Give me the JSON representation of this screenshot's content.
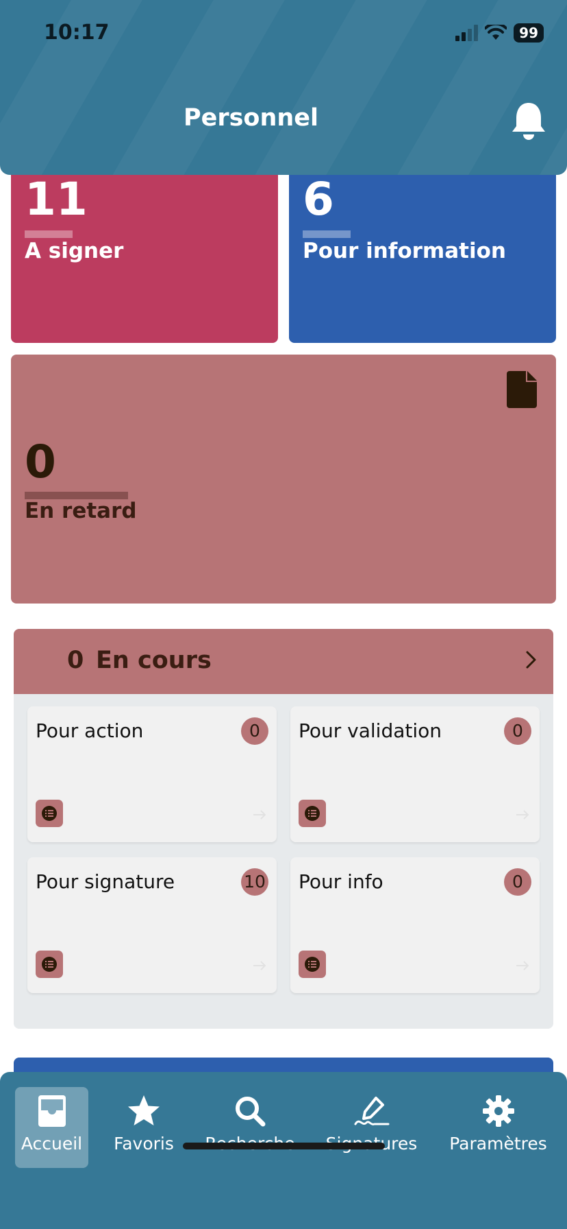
{
  "status_bar": {
    "time": "10:17",
    "battery": "99"
  },
  "header": {
    "title": "Personnel"
  },
  "tiles": {
    "sign": {
      "count": "11",
      "label": "A signer",
      "color": "#bc3c5f"
    },
    "info": {
      "count": "6",
      "label": "Pour information",
      "color": "#2d5fae"
    },
    "late": {
      "count": "0",
      "label": "En retard",
      "color": "#b77476"
    }
  },
  "en_cours": {
    "count": "0",
    "title": "En cours",
    "cards": [
      {
        "name": "Pour action",
        "badge": "0"
      },
      {
        "name": "Pour validation",
        "badge": "0"
      },
      {
        "name": "Pour signature",
        "badge": "10"
      },
      {
        "name": "Pour info",
        "badge": "0"
      }
    ]
  },
  "nav": {
    "active": "Accueil",
    "items": [
      {
        "label": "Accueil",
        "icon": "inbox-icon"
      },
      {
        "label": "Favoris",
        "icon": "star-icon"
      },
      {
        "label": "Recherche",
        "icon": "search-icon"
      },
      {
        "label": "Signatures",
        "icon": "signature-icon"
      },
      {
        "label": "Paramètres",
        "icon": "gear-icon"
      }
    ]
  },
  "colors": {
    "brand": "#367896",
    "accent_late": "#b77476"
  }
}
